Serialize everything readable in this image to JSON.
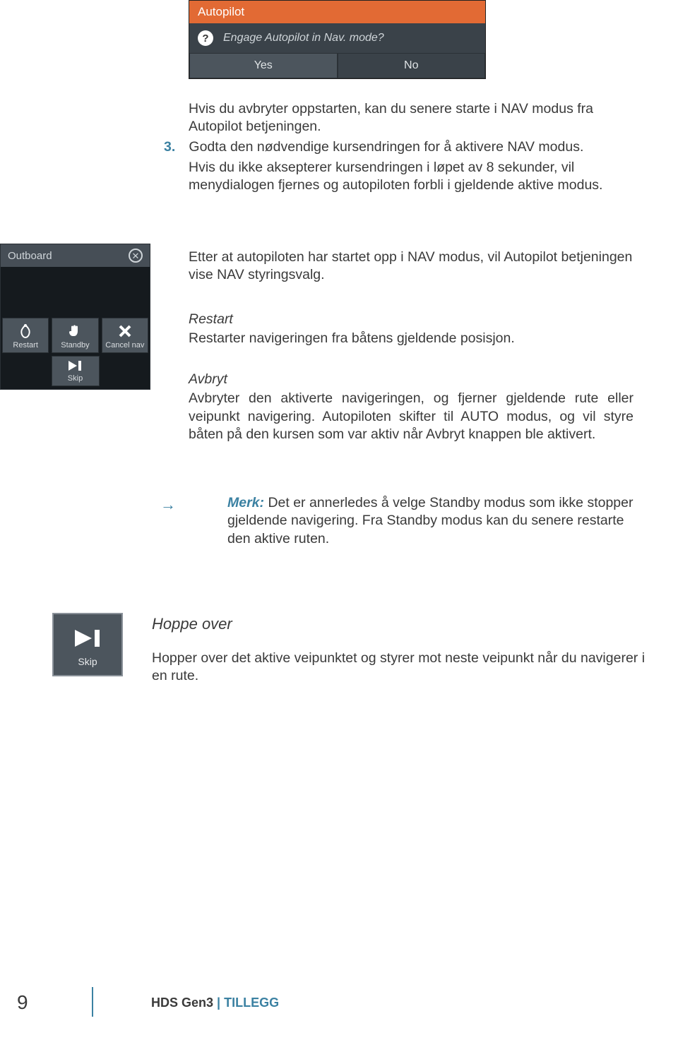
{
  "dialog": {
    "title": "Autopilot",
    "question": "Engage Autopilot in Nav. mode?",
    "yes": "Yes",
    "no": "No"
  },
  "body": {
    "para1": "Hvis du avbryter oppstarten, kan du senere starte i NAV modus fra Autopilot betjeningen.",
    "step3_num": "3.",
    "step3_txt": "Godta den nødvendige kursendringen for å aktivere NAV modus.",
    "para2": "Hvis du ikke aksepterer kursendringen i løpet av 8 sekunder, vil menydialogen fjernes og autopiloten forbli i gjeldende aktive modus."
  },
  "panel": {
    "title": "Outboard",
    "btn_restart": "Restart",
    "btn_standby": "Standby",
    "btn_cancel": "Cancel nav",
    "btn_skip": "Skip"
  },
  "sections": {
    "intro": "Etter at autopiloten har startet opp i NAV modus, vil Autopilot betjeningen vise NAV styringsvalg.",
    "restart_h": "Restart",
    "restart_b": "Restarter navigeringen fra båtens gjeldende posisjon.",
    "avbryt_h": "Avbryt",
    "avbryt_b": "Avbryter den aktiverte navigeringen, og fjerner gjeldende rute eller veipunkt navigering. Autopiloten skifter til AUTO modus, og vil styre båten på den kursen som var aktiv når Avbryt knappen ble aktivert."
  },
  "note": {
    "label": "Merk:",
    "text": "Det er annerledes å velge Standby modus som ikke stopper gjeldende navigering. Fra Standby modus kan du senere restarte den aktive ruten."
  },
  "skip": {
    "label": "Skip",
    "heading": "Hoppe over",
    "body": "Hopper over det aktive veipunktet og styrer mot neste veipunkt når du navigerer i en rute."
  },
  "footer": {
    "page": "9",
    "brand": "HDS Gen3",
    "separator": " | ",
    "suffix": "TILLEGG"
  }
}
